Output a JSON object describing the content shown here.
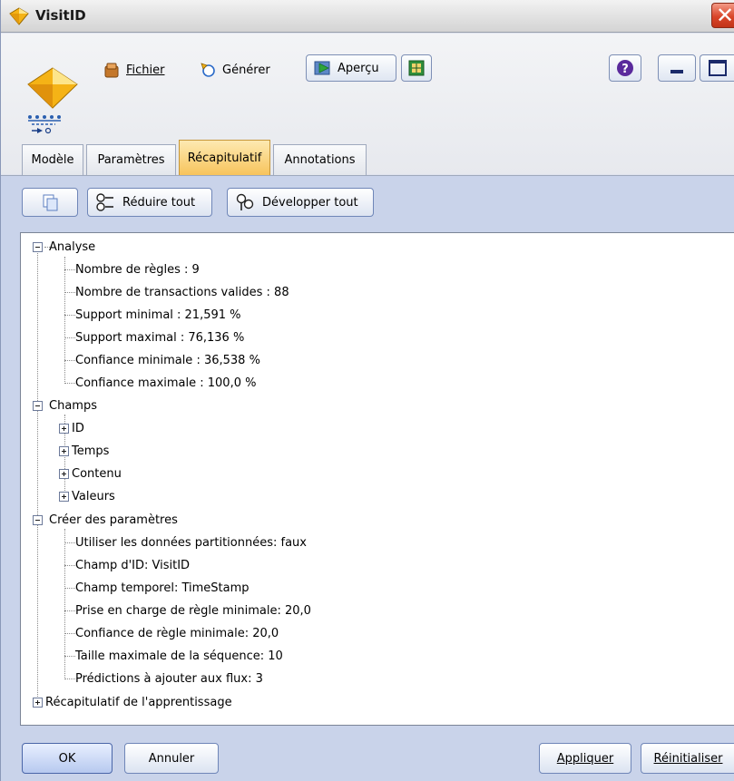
{
  "window": {
    "title": "VisitID"
  },
  "toolbar": {
    "file_label": "Fichier",
    "generate_label": "Générer",
    "preview_label": "Aperçu"
  },
  "tabs": [
    {
      "label": "Modèle",
      "active": false
    },
    {
      "label": "Paramètres",
      "active": false
    },
    {
      "label": "Récapitulatif",
      "active": true
    },
    {
      "label": "Annotations",
      "active": false
    }
  ],
  "summary_toolbar": {
    "collapse_all_label": "Réduire tout",
    "expand_all_label": "Développer tout"
  },
  "tree": {
    "analysis": {
      "label": "Analyse",
      "items": [
        "Nombre de règles : 9",
        "Nombre de transactions valides : 88",
        "Support minimal : 21,591 %",
        "Support maximal : 76,136 %",
        "Confiance minimale : 36,538 %",
        "Confiance maximale : 100,0 %"
      ]
    },
    "fields": {
      "label": "Champs",
      "items": [
        "ID",
        "Temps",
        "Contenu",
        "Valeurs"
      ]
    },
    "build_settings": {
      "label": "Créer des paramètres",
      "items": [
        "Utiliser les données partitionnées: faux",
        "Champ d'ID: VisitID",
        "Champ temporel: TimeStamp",
        "Prise en charge de règle minimale: 20,0",
        "Confiance de règle minimale: 20,0",
        "Taille maximale de la séquence: 10",
        "Prédictions à ajouter aux flux: 3"
      ]
    },
    "training_summary": {
      "label": "Récapitulatif de l'apprentissage"
    }
  },
  "buttons": {
    "ok": "OK",
    "cancel": "Annuler",
    "apply": "Appliquer",
    "reset": "Réinitialiser"
  },
  "icons": {
    "title": "model-nugget-icon",
    "file": "file-folder-icon",
    "generate": "generate-icon",
    "preview": "preview-play-icon",
    "export": "export-icon",
    "help": "help-icon",
    "minimize": "minimize-icon",
    "maximize": "maximize-icon",
    "close": "close-icon",
    "copy": "copy-icon",
    "collapse": "collapse-tree-icon",
    "expand": "expand-tree-icon"
  },
  "colors": {
    "active_tab": "#f7c35a",
    "close_button": "#d9462a",
    "panel_bg": "#c9d3ea"
  }
}
